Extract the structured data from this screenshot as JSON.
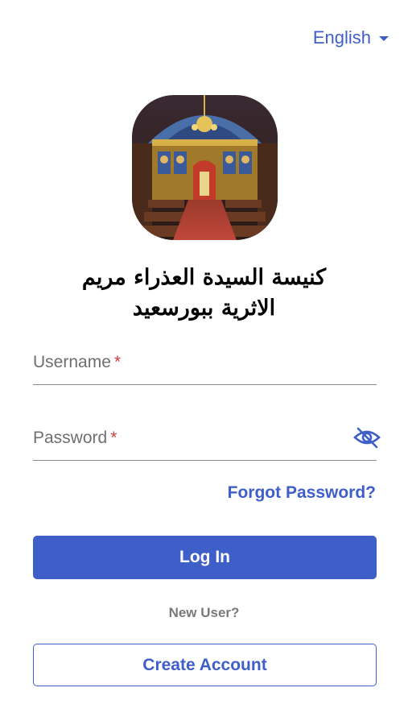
{
  "header": {
    "language_label": "English",
    "language_icon": "chevron-down-icon"
  },
  "logo": {
    "description_icon": "church-altar-image"
  },
  "church": {
    "name_line1": "كنيسة السيدة العذراء مريم",
    "name_line2": "الاثرية ببورسعيد"
  },
  "form": {
    "username_label": "Username",
    "password_label": "Password",
    "required_mark": "*",
    "password_toggle_icon": "eye-off-icon",
    "forgot_password": "Forgot Password?",
    "login_button": "Log In",
    "new_user_text": "New User?",
    "create_account_button": "Create Account"
  },
  "colors": {
    "accent": "#3f5fc8",
    "required": "#d23c3c",
    "muted": "#7a7a7a"
  }
}
